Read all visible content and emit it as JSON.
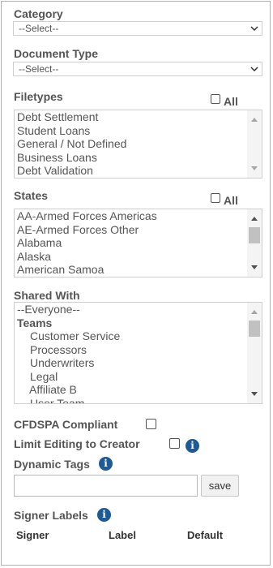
{
  "category": {
    "label": "Category",
    "selected": "--Select--"
  },
  "document_type": {
    "label": "Document Type",
    "selected": "--Select--"
  },
  "filetypes": {
    "label": "Filetypes",
    "all_label": "All",
    "items": [
      "Debt Settlement",
      "Student Loans",
      "General / Not Defined",
      "Business Loans",
      "Debt Validation"
    ]
  },
  "states": {
    "label": "States",
    "all_label": "All",
    "items": [
      "AA-Armed Forces Americas",
      "AE-Armed Forces Other",
      "Alabama",
      "Alaska",
      "American Samoa"
    ]
  },
  "shared_with": {
    "label": "Shared With",
    "items": [
      "--Everyone--",
      "Teams",
      "Customer Service",
      "Processors",
      "Underwriters",
      "Legal",
      "Affiliate B",
      "User Team"
    ]
  },
  "cfdspa": {
    "label": "CFDSPA Compliant"
  },
  "limit_editing": {
    "label": "Limit Editing to Creator"
  },
  "dynamic_tags": {
    "label": "Dynamic Tags",
    "value": "",
    "save_label": "save"
  },
  "signer_labels": {
    "label": "Signer Labels",
    "columns": [
      "Signer",
      "Label",
      "Default"
    ]
  },
  "icons": {
    "info": "info-icon",
    "dropdown": "chevron-down-icon"
  }
}
